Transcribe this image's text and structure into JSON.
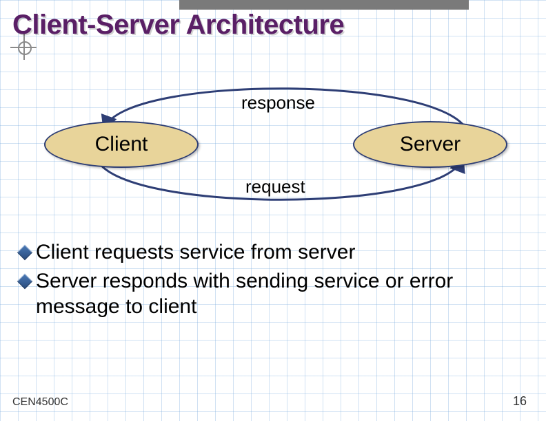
{
  "title": "Client-Server Architecture",
  "diagram": {
    "response_label": "response",
    "request_label": "request",
    "client_label": "Client",
    "server_label": "Server"
  },
  "bullets": [
    "Client requests service from server",
    "Server responds with sending service or error message to client"
  ],
  "footer": {
    "course": "CEN4500C",
    "page": "16"
  },
  "colors": {
    "title": "#5a1f66",
    "ellipse_fill": "#e8d49a",
    "ellipse_stroke": "#2e3e75",
    "arrow": "#2e3e75",
    "grid": "rgba(120,170,220,.35)"
  }
}
